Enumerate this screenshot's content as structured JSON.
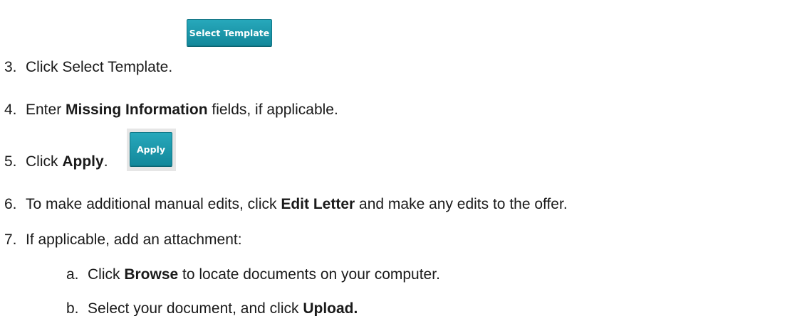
{
  "steps": {
    "s3": {
      "num": "3.",
      "pre": "Click Select Template.",
      "button_label": "Select Template"
    },
    "s4": {
      "num": "4.",
      "pre": "Enter ",
      "bold": "Missing Information",
      "post": " fields, if applicable."
    },
    "s5": {
      "num": "5.",
      "pre": "Click ",
      "bold": "Apply",
      "post": ".",
      "button_label": "Apply"
    },
    "s6": {
      "num": "6.",
      "pre": "To make additional manual edits, click ",
      "bold": "Edit Letter",
      "post": " and make any edits to the offer."
    },
    "s7": {
      "num": "7.",
      "text": "If applicable, add an attachment:",
      "sub": [
        {
          "num": "a.",
          "pre": "Click ",
          "bold": "Browse",
          "post": " to locate documents on your computer."
        },
        {
          "num": "b.",
          "pre": "Select your document, and click ",
          "bold": "Upload."
        }
      ]
    }
  }
}
